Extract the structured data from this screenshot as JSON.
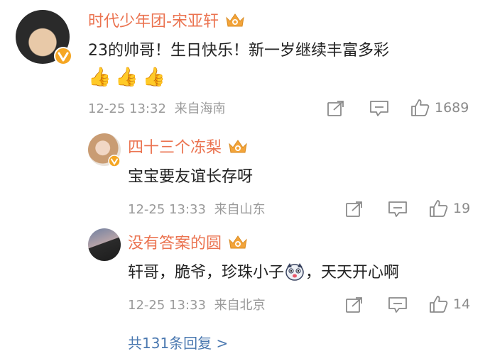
{
  "comments": [
    {
      "name": "时代少年团-宋亚轩",
      "text": "23的帅哥！生日快乐！新一岁继续丰富多彩",
      "emoji_line": "👍👍👍",
      "time": "12-25 13:32",
      "location": "来自海南",
      "likes": "1689"
    }
  ],
  "replies": [
    {
      "name": "四十三个冻梨",
      "text": "宝宝要友谊长存呀",
      "time": "12-25 13:33",
      "location": "来自山东",
      "likes": "19"
    },
    {
      "name": "没有答案的圆",
      "text_before": "轩哥，脆爷，珍珠小子",
      "text_after": "，天天开心啊",
      "time": "12-25 13:33",
      "location": "来自北京",
      "likes": "14"
    }
  ],
  "more_replies": "共131条回复 >",
  "icons": [
    "crown-icon",
    "verified-badge-icon",
    "share-icon",
    "comment-icon",
    "like-icon",
    "dog-emoji-icon"
  ],
  "colors": {
    "name": "#eb7350",
    "link": "#4a78b0",
    "meta": "#9a9a9a"
  }
}
